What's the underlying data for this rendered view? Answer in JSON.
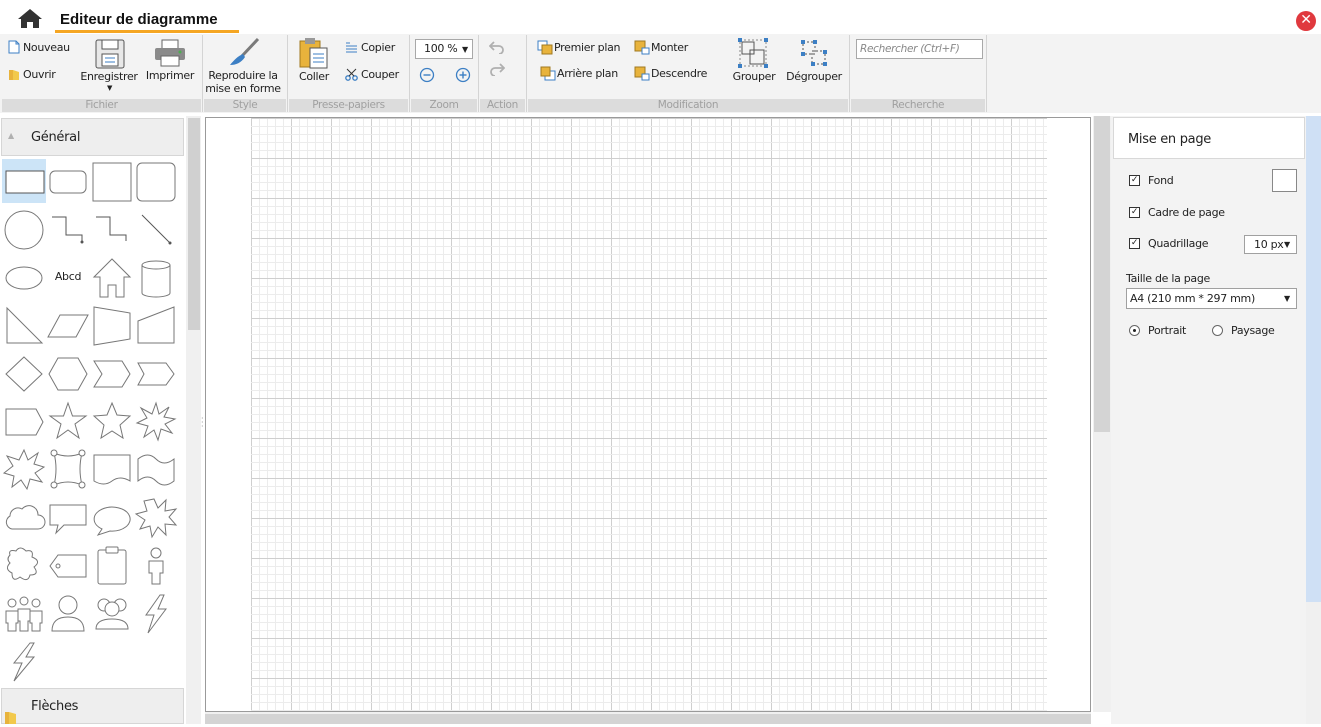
{
  "title_bar": {
    "app_title": "Editeur de diagramme",
    "close_glyph": "✕"
  },
  "ribbon": {
    "file_group": {
      "label": "Fichier",
      "new": "Nouveau",
      "open": "Ouvrir",
      "save": "Enregistrer",
      "print": "Imprimer"
    },
    "style_group": {
      "label": "Style",
      "format_painter_line1": "Reproduire la",
      "format_painter_line2": "mise en forme"
    },
    "clipboard_group": {
      "label": "Presse-papiers",
      "paste": "Coller",
      "copy": "Copier",
      "cut": "Couper"
    },
    "zoom_group": {
      "label": "Zoom",
      "value": "100 %"
    },
    "action_group": {
      "label": "Action"
    },
    "modification_group": {
      "label": "Modification",
      "bring_front": "Premier plan",
      "send_back": "Arrière plan",
      "move_up": "Monter",
      "move_down": "Descendre",
      "group": "Grouper",
      "ungroup": "Dégrouper"
    },
    "search_group": {
      "label": "Recherche",
      "placeholder": "Rechercher (Ctrl+F)"
    }
  },
  "shape_panel": {
    "general_header": "Général",
    "arrows_header": "Flèches",
    "text_shape_label": "Abcd",
    "shapes": [
      "rectangle",
      "rounded-rectangle",
      "square",
      "rounded-square",
      "circle",
      "elbow-connector",
      "elbow-connector-2",
      "diagonal-line",
      "ellipse",
      "text",
      "house",
      "cylinder",
      "right-triangle",
      "parallelogram",
      "trapezoid",
      "manual-input",
      "diamond",
      "hexagon",
      "chevron",
      "arrow-pentagon",
      "pentagon-tag",
      "star-5",
      "star-5-alt",
      "burst",
      "burst-2",
      "frame",
      "document",
      "wave",
      "cloud",
      "callout-rect",
      "callout-oval",
      "callout-burst",
      "puzzle",
      "tag",
      "clipboard",
      "person-standing",
      "people-group",
      "person-bust",
      "people-pair",
      "lightning",
      "lightning-2"
    ]
  },
  "layout_panel": {
    "title": "Mise en page",
    "fond_label": "Fond",
    "fond_checked": true,
    "page_frame_label": "Cadre de page",
    "page_frame_checked": true,
    "grid_label": "Quadrillage",
    "grid_checked": true,
    "grid_size": "10 px",
    "page_size_label": "Taille de la page",
    "page_size": "A4 (210 mm * 297 mm)",
    "orientation_portrait": "Portrait",
    "orientation_landscape": "Paysage",
    "orientation_selected": "Portrait"
  },
  "colors": {
    "accent": "#f5a623",
    "close": "#e0393e",
    "selected_shape": "#cce4f7",
    "icon_blue": "#3c7fc4"
  }
}
